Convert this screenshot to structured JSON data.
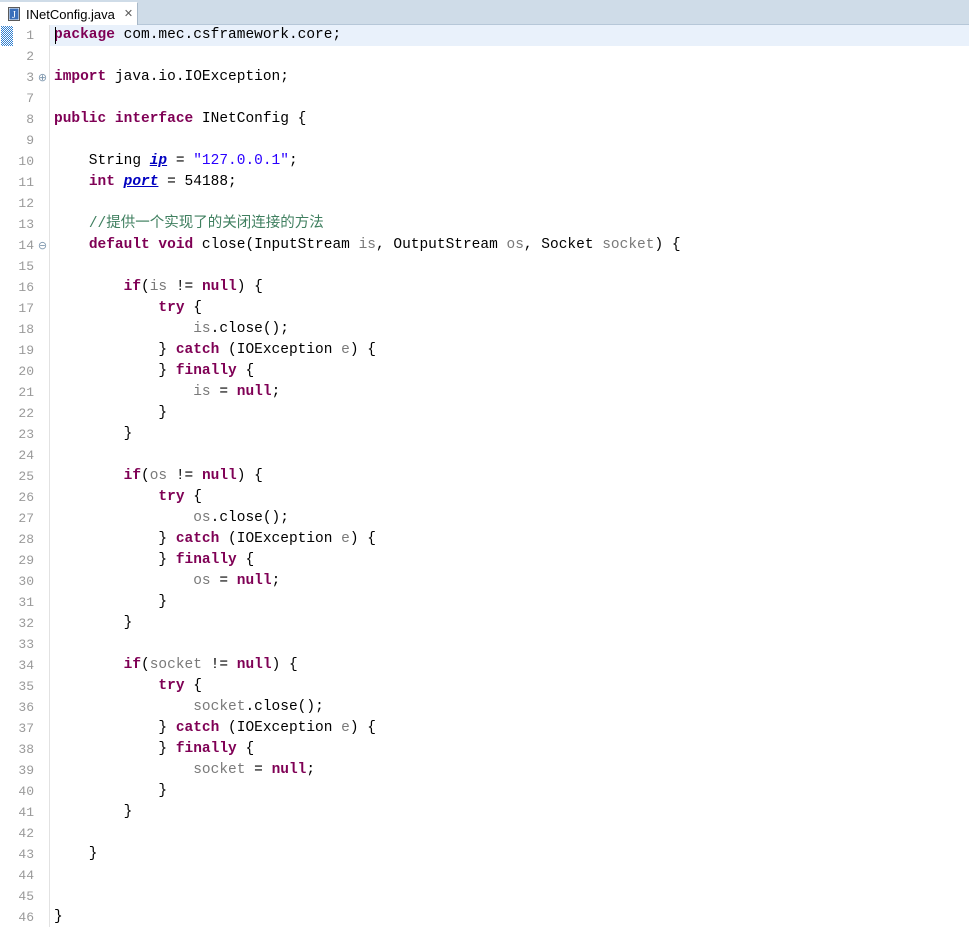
{
  "window": {
    "app": "Eclipse IDE",
    "kind": "java-editor"
  },
  "tab": {
    "title": "INetConfig.java",
    "icon": "java-file-icon",
    "close_glyph": "✕",
    "active": true
  },
  "colors": {
    "tab_bar_bg": "#cfdce8",
    "editor_bg": "#ffffff",
    "current_line_bg": "#e9f1fb",
    "line_number": "#9a9a9a",
    "keyword": "#7f0055",
    "string": "#2a00ff",
    "comment": "#3f7f5f",
    "field": "#0000c0",
    "parameter": "#7a7a7a",
    "change_marker": "#2f7fd0",
    "fold_marker": "#7d96ad"
  },
  "editor": {
    "language": "java",
    "caret_line": 1,
    "caret_column": 1,
    "first_visible_line": 1,
    "last_visible_line": 46,
    "total_displayed_rows": 43,
    "folded_region": "import block collapsed between line 3 and line 7",
    "line_numbers": [
      1,
      2,
      3,
      7,
      8,
      9,
      10,
      11,
      12,
      13,
      14,
      15,
      16,
      17,
      18,
      19,
      20,
      21,
      22,
      23,
      24,
      25,
      26,
      27,
      28,
      29,
      30,
      31,
      32,
      33,
      34,
      35,
      36,
      37,
      38,
      39,
      40,
      41,
      42,
      43,
      44,
      45,
      46
    ],
    "fold_markers": [
      {
        "row_index": 2,
        "line": 3,
        "glyph": "⊕",
        "state": "collapsed"
      },
      {
        "row_index": 10,
        "line": 14,
        "glyph": "⊖",
        "state": "expanded"
      }
    ],
    "change_markers": [
      {
        "row_index": 0,
        "line": 1
      }
    ],
    "lines": [
      {
        "n": 1,
        "current": true,
        "tokens": [
          {
            "t": "kw",
            "v": "package"
          },
          {
            "t": "plain",
            "v": " com.mec.csframework.core;"
          }
        ]
      },
      {
        "n": 2,
        "tokens": []
      },
      {
        "n": 3,
        "tokens": [
          {
            "t": "kw",
            "v": "import"
          },
          {
            "t": "plain",
            "v": " java.io.IOException;"
          }
        ]
      },
      {
        "n": 7,
        "tokens": []
      },
      {
        "n": 8,
        "tokens": [
          {
            "t": "kw",
            "v": "public interface"
          },
          {
            "t": "plain",
            "v": " INetConfig {"
          }
        ]
      },
      {
        "n": 9,
        "tokens": []
      },
      {
        "n": 10,
        "tokens": [
          {
            "t": "plain",
            "v": "    String "
          },
          {
            "t": "field",
            "v": "ip"
          },
          {
            "t": "plain",
            "v": " = "
          },
          {
            "t": "str",
            "v": "\"127.0.0.1\""
          },
          {
            "t": "plain",
            "v": ";"
          }
        ]
      },
      {
        "n": 11,
        "tokens": [
          {
            "t": "plain",
            "v": "    "
          },
          {
            "t": "kw",
            "v": "int"
          },
          {
            "t": "plain",
            "v": " "
          },
          {
            "t": "field",
            "v": "port"
          },
          {
            "t": "plain",
            "v": " = 54188;"
          }
        ]
      },
      {
        "n": 12,
        "tokens": []
      },
      {
        "n": 13,
        "tokens": [
          {
            "t": "plain",
            "v": "    "
          },
          {
            "t": "cmt",
            "v": "//提供一个实现了的关闭连接的方法"
          }
        ]
      },
      {
        "n": 14,
        "tokens": [
          {
            "t": "plain",
            "v": "    "
          },
          {
            "t": "kw",
            "v": "default void"
          },
          {
            "t": "plain",
            "v": " close(InputStream "
          },
          {
            "t": "param",
            "v": "is"
          },
          {
            "t": "plain",
            "v": ", OutputStream "
          },
          {
            "t": "param",
            "v": "os"
          },
          {
            "t": "plain",
            "v": ", Socket "
          },
          {
            "t": "param",
            "v": "socket"
          },
          {
            "t": "plain",
            "v": ") {"
          }
        ]
      },
      {
        "n": 15,
        "tokens": []
      },
      {
        "n": 16,
        "tokens": [
          {
            "t": "plain",
            "v": "        "
          },
          {
            "t": "kw",
            "v": "if"
          },
          {
            "t": "plain",
            "v": "("
          },
          {
            "t": "param",
            "v": "is"
          },
          {
            "t": "plain",
            "v": " != "
          },
          {
            "t": "kw",
            "v": "null"
          },
          {
            "t": "plain",
            "v": ") {"
          }
        ]
      },
      {
        "n": 17,
        "tokens": [
          {
            "t": "plain",
            "v": "            "
          },
          {
            "t": "kw",
            "v": "try"
          },
          {
            "t": "plain",
            "v": " {"
          }
        ]
      },
      {
        "n": 18,
        "tokens": [
          {
            "t": "plain",
            "v": "                "
          },
          {
            "t": "param",
            "v": "is"
          },
          {
            "t": "plain",
            "v": ".close();"
          }
        ]
      },
      {
        "n": 19,
        "tokens": [
          {
            "t": "plain",
            "v": "            } "
          },
          {
            "t": "kw",
            "v": "catch"
          },
          {
            "t": "plain",
            "v": " (IOException "
          },
          {
            "t": "param",
            "v": "e"
          },
          {
            "t": "plain",
            "v": ") {"
          }
        ]
      },
      {
        "n": 20,
        "tokens": [
          {
            "t": "plain",
            "v": "            } "
          },
          {
            "t": "kw",
            "v": "finally"
          },
          {
            "t": "plain",
            "v": " {"
          }
        ]
      },
      {
        "n": 21,
        "tokens": [
          {
            "t": "plain",
            "v": "                "
          },
          {
            "t": "param",
            "v": "is"
          },
          {
            "t": "plain",
            "v": " = "
          },
          {
            "t": "kw",
            "v": "null"
          },
          {
            "t": "plain",
            "v": ";"
          }
        ]
      },
      {
        "n": 22,
        "tokens": [
          {
            "t": "plain",
            "v": "            }"
          }
        ]
      },
      {
        "n": 23,
        "tokens": [
          {
            "t": "plain",
            "v": "        }"
          }
        ]
      },
      {
        "n": 24,
        "tokens": []
      },
      {
        "n": 25,
        "tokens": [
          {
            "t": "plain",
            "v": "        "
          },
          {
            "t": "kw",
            "v": "if"
          },
          {
            "t": "plain",
            "v": "("
          },
          {
            "t": "param",
            "v": "os"
          },
          {
            "t": "plain",
            "v": " != "
          },
          {
            "t": "kw",
            "v": "null"
          },
          {
            "t": "plain",
            "v": ") {"
          }
        ]
      },
      {
        "n": 26,
        "tokens": [
          {
            "t": "plain",
            "v": "            "
          },
          {
            "t": "kw",
            "v": "try"
          },
          {
            "t": "plain",
            "v": " {"
          }
        ]
      },
      {
        "n": 27,
        "tokens": [
          {
            "t": "plain",
            "v": "                "
          },
          {
            "t": "param",
            "v": "os"
          },
          {
            "t": "plain",
            "v": ".close();"
          }
        ]
      },
      {
        "n": 28,
        "tokens": [
          {
            "t": "plain",
            "v": "            } "
          },
          {
            "t": "kw",
            "v": "catch"
          },
          {
            "t": "plain",
            "v": " (IOException "
          },
          {
            "t": "param",
            "v": "e"
          },
          {
            "t": "plain",
            "v": ") {"
          }
        ]
      },
      {
        "n": 29,
        "tokens": [
          {
            "t": "plain",
            "v": "            } "
          },
          {
            "t": "kw",
            "v": "finally"
          },
          {
            "t": "plain",
            "v": " {"
          }
        ]
      },
      {
        "n": 30,
        "tokens": [
          {
            "t": "plain",
            "v": "                "
          },
          {
            "t": "param",
            "v": "os"
          },
          {
            "t": "plain",
            "v": " = "
          },
          {
            "t": "kw",
            "v": "null"
          },
          {
            "t": "plain",
            "v": ";"
          }
        ]
      },
      {
        "n": 31,
        "tokens": [
          {
            "t": "plain",
            "v": "            }"
          }
        ]
      },
      {
        "n": 32,
        "tokens": [
          {
            "t": "plain",
            "v": "        }"
          }
        ]
      },
      {
        "n": 33,
        "tokens": []
      },
      {
        "n": 34,
        "tokens": [
          {
            "t": "plain",
            "v": "        "
          },
          {
            "t": "kw",
            "v": "if"
          },
          {
            "t": "plain",
            "v": "("
          },
          {
            "t": "param",
            "v": "socket"
          },
          {
            "t": "plain",
            "v": " != "
          },
          {
            "t": "kw",
            "v": "null"
          },
          {
            "t": "plain",
            "v": ") {"
          }
        ]
      },
      {
        "n": 35,
        "tokens": [
          {
            "t": "plain",
            "v": "            "
          },
          {
            "t": "kw",
            "v": "try"
          },
          {
            "t": "plain",
            "v": " {"
          }
        ]
      },
      {
        "n": 36,
        "tokens": [
          {
            "t": "plain",
            "v": "                "
          },
          {
            "t": "param",
            "v": "socket"
          },
          {
            "t": "plain",
            "v": ".close();"
          }
        ]
      },
      {
        "n": 37,
        "tokens": [
          {
            "t": "plain",
            "v": "            } "
          },
          {
            "t": "kw",
            "v": "catch"
          },
          {
            "t": "plain",
            "v": " (IOException "
          },
          {
            "t": "param",
            "v": "e"
          },
          {
            "t": "plain",
            "v": ") {"
          }
        ]
      },
      {
        "n": 38,
        "tokens": [
          {
            "t": "plain",
            "v": "            } "
          },
          {
            "t": "kw",
            "v": "finally"
          },
          {
            "t": "plain",
            "v": " {"
          }
        ]
      },
      {
        "n": 39,
        "tokens": [
          {
            "t": "plain",
            "v": "                "
          },
          {
            "t": "param",
            "v": "socket"
          },
          {
            "t": "plain",
            "v": " = "
          },
          {
            "t": "kw",
            "v": "null"
          },
          {
            "t": "plain",
            "v": ";"
          }
        ]
      },
      {
        "n": 40,
        "tokens": [
          {
            "t": "plain",
            "v": "            }"
          }
        ]
      },
      {
        "n": 41,
        "tokens": [
          {
            "t": "plain",
            "v": "        }"
          }
        ]
      },
      {
        "n": 42,
        "tokens": []
      },
      {
        "n": 43,
        "tokens": [
          {
            "t": "plain",
            "v": "    }"
          }
        ]
      },
      {
        "n": 44,
        "tokens": []
      },
      {
        "n": 45,
        "tokens": []
      },
      {
        "n": 46,
        "tokens": [
          {
            "t": "plain",
            "v": "}"
          }
        ]
      }
    ]
  }
}
